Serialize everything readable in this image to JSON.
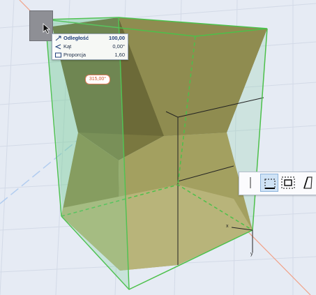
{
  "tracker": {
    "rows": [
      {
        "icon": "distance-icon",
        "label": "Odległość",
        "value": "100,00",
        "bold": true
      },
      {
        "icon": "angle-icon",
        "label": "Kąt",
        "value": "0,00°",
        "bold": false
      },
      {
        "icon": "proportion-icon",
        "label": "Proporcja",
        "value": "1,60",
        "bold": false
      }
    ]
  },
  "angle_badge": "315,00°",
  "axes": {
    "x": "x",
    "y": "y"
  },
  "pet_palette": {
    "buttons": [
      {
        "name": "pet-line-icon",
        "active": false
      },
      {
        "name": "pet-offset-edge-icon",
        "active": true
      },
      {
        "name": "pet-offset-all-icon",
        "active": false
      },
      {
        "name": "pet-skew-icon",
        "active": false
      }
    ]
  },
  "colors": {
    "background": "#e6ebf4",
    "grid": "#d2d9e6",
    "solid_fill": "#9f9b58",
    "selection_green": "#4cc04a",
    "guide_orange": "#f08a66",
    "guide_blue": "#a9c8ee"
  }
}
